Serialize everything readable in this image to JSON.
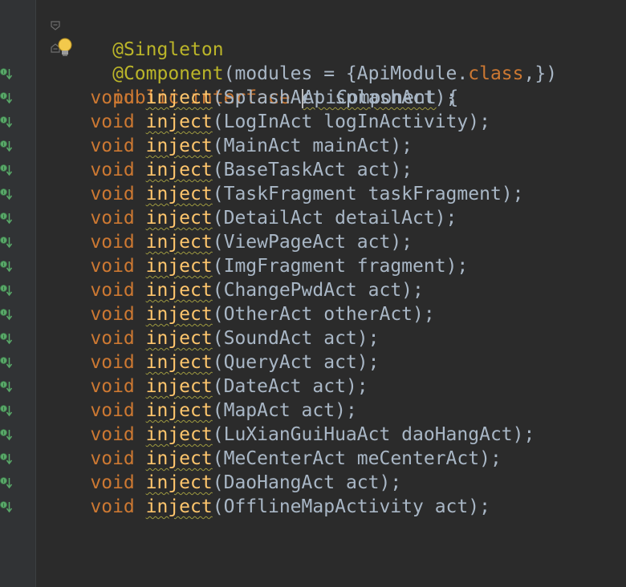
{
  "code": {
    "line1": {
      "annotation": "@Singleton"
    },
    "line2": {
      "at": "@C",
      "rest": "omponent",
      "open": "(",
      "attr": "modules",
      "eq": " = {",
      "cls": "ApiModule",
      "dot": ".",
      "kw": "class",
      "close": ",})"
    },
    "line3": {
      "public": "public",
      "interface": "interface",
      "name": "ApiComponent",
      "brace": " {"
    },
    "methods": [
      {
        "type": "SplashAct",
        "param": "splashAct"
      },
      {
        "type": "LogInAct",
        "param": "logInActivity"
      },
      {
        "type": "MainAct",
        "param": "mainAct"
      },
      {
        "type": "BaseTaskAct",
        "param": "act"
      },
      {
        "type": "TaskFragment",
        "param": "taskFragment"
      },
      {
        "type": "DetailAct",
        "param": "detailAct"
      },
      {
        "type": "ViewPageAct",
        "param": "act"
      },
      {
        "type": "ImgFragment",
        "param": "fragment"
      },
      {
        "type": "ChangePwdAct",
        "param": "act"
      },
      {
        "type": "OtherAct",
        "param": "otherAct"
      },
      {
        "type": "SoundAct",
        "param": "act"
      },
      {
        "type": "QueryAct",
        "param": "act"
      },
      {
        "type": "DateAct",
        "param": "act"
      },
      {
        "type": "MapAct",
        "param": "act"
      },
      {
        "type": "LuXianGuiHuaAct",
        "param": "daoHangAct"
      },
      {
        "type": "MeCenterAct",
        "param": "meCenterAct"
      },
      {
        "type": "DaoHangAct",
        "param": "act"
      },
      {
        "type": "OfflineMapActivity",
        "param": "act"
      }
    ],
    "keyword_void": "void",
    "method_name": "inject",
    "closing_brace": "}"
  },
  "icons": {
    "gutter_mark": "implementation-arrow-icon",
    "fold": "fold-marker-icon",
    "intention": "lightbulb-icon"
  },
  "colors": {
    "background": "#2b2b2b",
    "gutter": "#313335",
    "keyword": "#cc7832",
    "annotation": "#bbb529",
    "method": "#ffc66d",
    "text": "#a9b7c6",
    "gutter_icon": "#59a869"
  }
}
